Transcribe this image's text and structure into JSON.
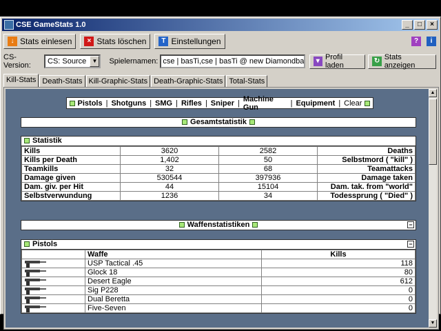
{
  "window": {
    "title": "CSE GameStats 1.0"
  },
  "toolbar": {
    "read_label": "Stats einlesen",
    "delete_label": "Stats löschen",
    "settings_label": "Einstellungen"
  },
  "options": {
    "version_label": "CS-Version:",
    "version_value": "CS: Source",
    "names_label": "Spielernamen:",
    "names_value": "cse | basTi,cse | basTi @ new Diamondback,hallo d",
    "load_profile_label": "Profil laden",
    "show_stats_label": "Stats anzeigen"
  },
  "tabs": [
    "Kill-Stats",
    "Death-Stats",
    "Kill-Graphic-Stats",
    "Death-Graphic-Stats",
    "Total-Stats"
  ],
  "filter": {
    "items": [
      "Pistols",
      "Shotguns",
      "SMG",
      "Rifles",
      "Sniper",
      "Machine Gun",
      "Equipment"
    ],
    "clear": "Clear"
  },
  "summary": {
    "title": "Gesamtstatistik",
    "section": "Statistik",
    "rows": [
      {
        "left": "Kills",
        "v1": "3620",
        "v2": "2582",
        "right": "Deaths"
      },
      {
        "left": "Kills per Death",
        "v1": "1,402",
        "v2": "50",
        "right": "Selbstmord ( \"kill\" )"
      },
      {
        "left": "Teamkills",
        "v1": "32",
        "v2": "68",
        "right": "Teamattacks"
      },
      {
        "left": "Damage given",
        "v1": "530544",
        "v2": "397936",
        "right": "Damage taken"
      },
      {
        "left": "Dam. giv. per Hit",
        "v1": "44",
        "v2": "15104",
        "right": "Dam. tak. from \"world\""
      },
      {
        "left": "Selbstverwundung",
        "v1": "1236",
        "v2": "34",
        "right": "Todessprung ( \"Died\" )"
      }
    ]
  },
  "weapons": {
    "title": "Waffenstatistiken",
    "collapse": "−",
    "section": "Pistols",
    "col_weapon": "Waffe",
    "col_kills": "Kills",
    "rows": [
      {
        "name": "USP Tactical .45",
        "kills": "118"
      },
      {
        "name": "Glock 18",
        "kills": "80"
      },
      {
        "name": "Desert Eagle",
        "kills": "612"
      },
      {
        "name": "Sig P228",
        "kills": "0"
      },
      {
        "name": "Dual Beretta",
        "kills": "0"
      },
      {
        "name": "Five-Seven",
        "kills": "0"
      }
    ]
  }
}
